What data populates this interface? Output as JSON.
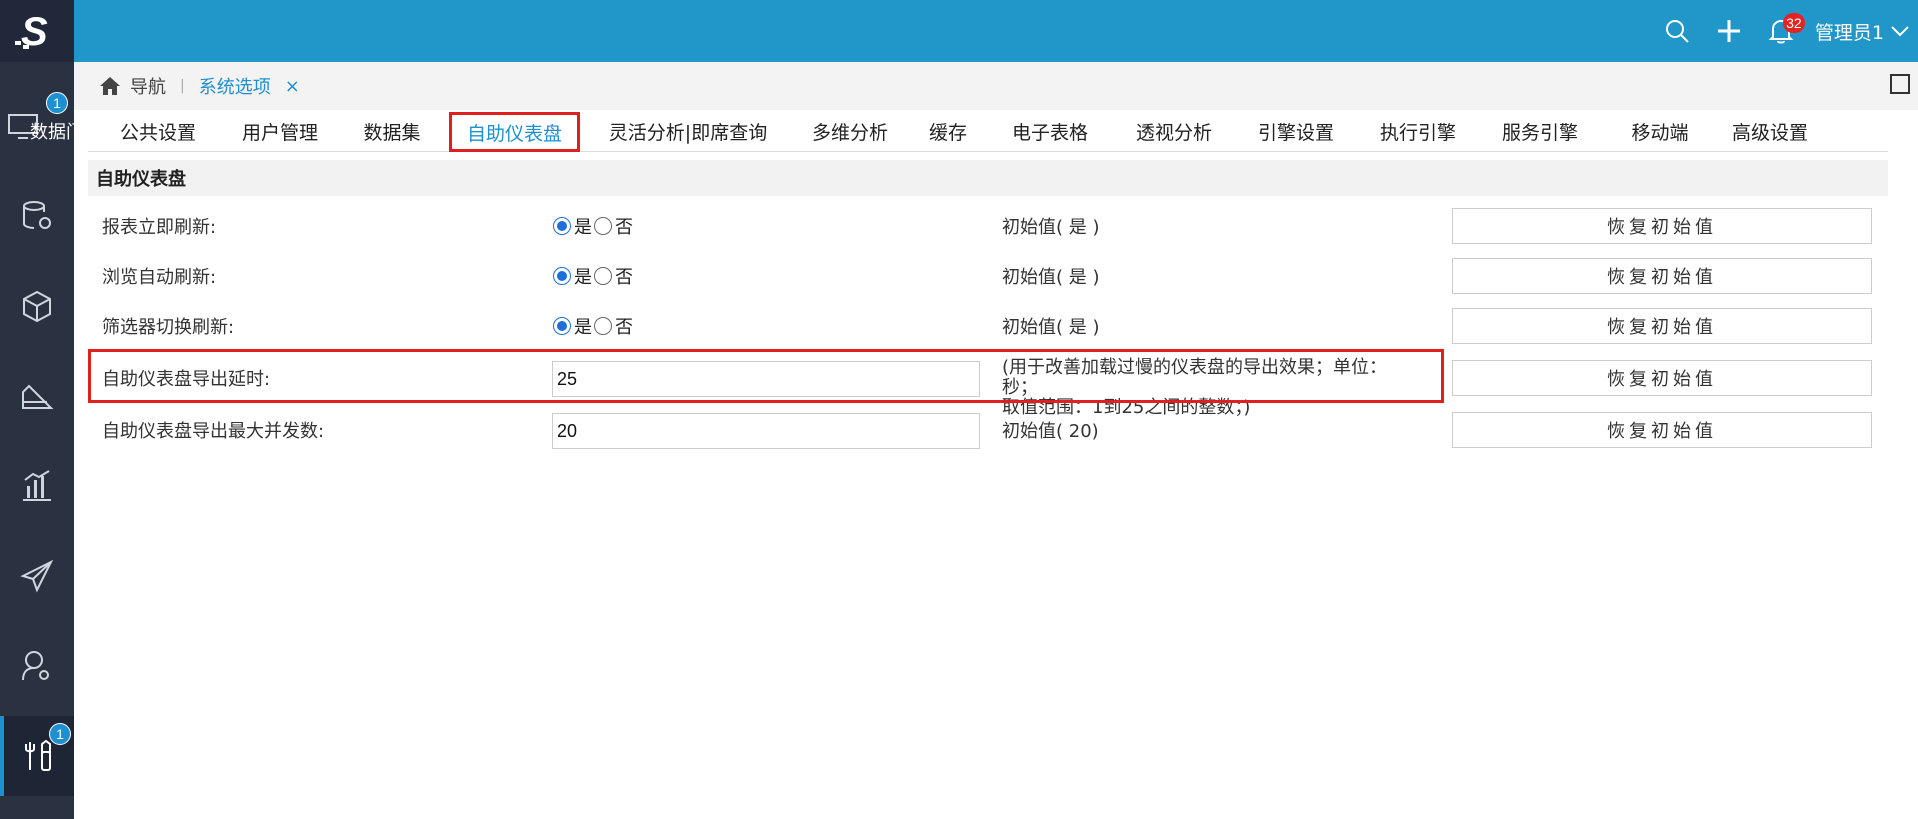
{
  "sidebar": {
    "logo": "S",
    "badges": {
      "data": "1",
      "tools": "1"
    },
    "data_label": "数据门",
    "icons": [
      "monitor-icon",
      "database-gear-icon",
      "cube-icon",
      "ruler-icon",
      "bar-chart-icon",
      "paper-plane-icon",
      "user-gear-icon",
      "tools-icon"
    ]
  },
  "header": {
    "notification_count": "32",
    "user_name": "管理员1"
  },
  "breadcrumb": {
    "home_label": "导航",
    "separator": "|",
    "active_label": "系统选项",
    "close": "×"
  },
  "tabs": [
    {
      "label": "公共设置"
    },
    {
      "label": "用户管理"
    },
    {
      "label": "数据集"
    },
    {
      "label": "自助仪表盘"
    },
    {
      "label": "灵活分析|即席查询"
    },
    {
      "label": "多维分析"
    },
    {
      "label": "缓存"
    },
    {
      "label": "电子表格"
    },
    {
      "label": "透视分析"
    },
    {
      "label": "引擎设置"
    },
    {
      "label": "执行引擎"
    },
    {
      "label": "服务引擎"
    },
    {
      "label": "移动端"
    },
    {
      "label": "高级设置"
    }
  ],
  "section_title": "自助仪表盘",
  "radio_yes": "是",
  "radio_no": "否",
  "reset_label": "恢复初始值",
  "rows": [
    {
      "label": "报表立即刷新:",
      "value": "是",
      "initial": "初始值( 是 )"
    },
    {
      "label": "浏览自动刷新:",
      "value": "是",
      "initial": "初始值( 是 )"
    },
    {
      "label": "筛选器切换刷新:",
      "value": "是",
      "initial": "初始值( 是 )"
    },
    {
      "label": "自助仪表盘导出延时:",
      "value": "25",
      "note_line1": "(用于改善加载过慢的仪表盘的导出效果；单位：秒；",
      "note_line2": "取值范围：1到25之间的整数；)"
    },
    {
      "label": "自助仪表盘导出最大并发数:",
      "value": "20",
      "initial": "初始值( 20)"
    }
  ],
  "colors": {
    "accent": "#1e90d0",
    "header": "#2196c9",
    "sidebar": "#2a3241",
    "highlight": "#e01f1f"
  }
}
